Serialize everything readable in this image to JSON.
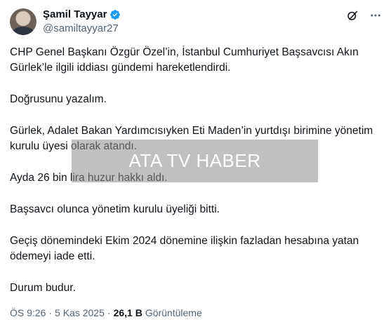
{
  "author": {
    "name": "Şamil Tayyar",
    "handle": "@samiltayyar27",
    "avatar_icon": "profile-photo",
    "verified_icon": "verified-badge-icon",
    "verified_color": "#1d9bf0"
  },
  "header_icons": [
    "grok-icon",
    "more-icon"
  ],
  "post": {
    "paragraphs": [
      "CHP Genel Başkanı Özgür Özel’in, İstanbul Cumhuriyet Başsavcısı Akın Gürlek’le ilgili iddiası gündemi hareketlendirdi.",
      "Doğrusunu yazalım.",
      "Gürlek, Adalet Bakan Yardımcısıyken Eti Maden’in yurtdışı birimine yönetim kurulu üyesi olarak atandı.",
      "Ayda 26 bin lira huzur hakkı aldı.",
      "Başsavcı olunca yönetim kurulu üyeliği bitti.",
      "Geçiş dönemindeki Ekim 2024 dönemine ilişkin fazladan hesabına yatan ödemeyi iade etti.",
      "Durum budur."
    ]
  },
  "watermark": {
    "text": "ATA TV HABER"
  },
  "meta": {
    "time": "ÖS 9:26",
    "separator1": "·",
    "date": "5 Kas 2025",
    "separator2": "·",
    "views_count": "26,1 B",
    "views_label": "Görüntüleme"
  }
}
